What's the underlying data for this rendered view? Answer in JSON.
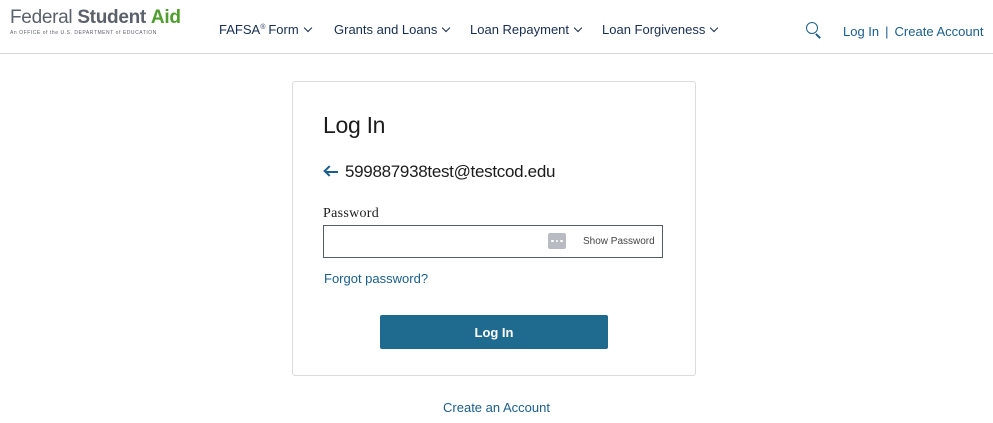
{
  "header": {
    "logo": {
      "federal": "Federal",
      "student": "Student",
      "aid": "Aid",
      "tagline": "An OFFICE of the U.S. DEPARTMENT of EDUCATION"
    },
    "nav": [
      {
        "label": "FAFSA",
        "sup": "®",
        "suffix": "Form"
      },
      {
        "label": "Grants and Loans"
      },
      {
        "label": "Loan Repayment"
      },
      {
        "label": "Loan Forgiveness"
      }
    ],
    "search_icon": "search-icon",
    "login_label": "Log In",
    "separator": "|",
    "create_account_label": "Create Account"
  },
  "login_card": {
    "title": "Log In",
    "back_icon": "arrow-left-icon",
    "email": "599887938test@testcod.edu",
    "password_label": "Password",
    "password_value": "",
    "password_icon": "password-dots-icon",
    "show_password_label": "Show Password",
    "forgot_password_label": "Forgot password?",
    "submit_label": "Log In"
  },
  "footer": {
    "create_account_link": "Create an Account"
  },
  "colors": {
    "brand_green": "#4e9d2d",
    "link_blue": "#1a5e8c",
    "button_blue": "#1f6a8f"
  }
}
